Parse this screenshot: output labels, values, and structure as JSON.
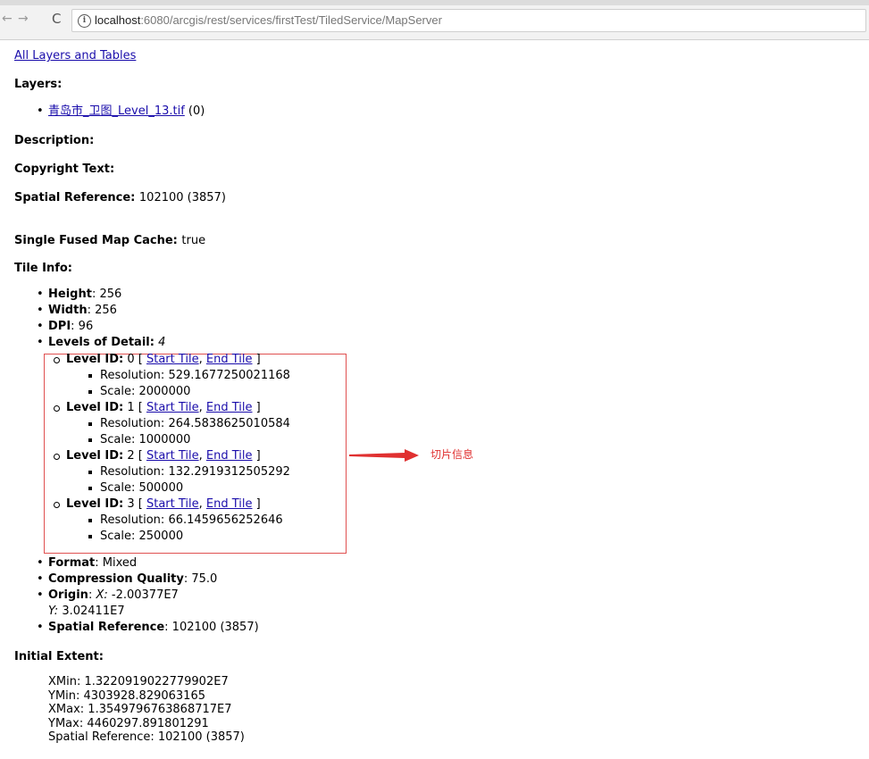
{
  "browser": {
    "url_host": "localhost",
    "url_path": ":6080/arcgis/rest/services/firstTest/TiledService/MapServer"
  },
  "page": {
    "all_layers_link": "All Layers and Tables",
    "layers_label": "Layers:",
    "layer_name": "青岛市_卫图_Level_13.tif",
    "layer_id": "(0)",
    "description_label": "Description:",
    "copyright_label": "Copyright Text:",
    "spatial_ref_label": "Spatial Reference:",
    "spatial_ref_value": "102100  (3857)",
    "fused_cache_label": "Single Fused Map Cache:",
    "fused_cache_value": "true",
    "tile_info_label": "Tile Info:"
  },
  "tile_info": {
    "height_label": "Height",
    "height_value": ": 256",
    "width_label": "Width",
    "width_value": ": 256",
    "dpi_label": "DPI",
    "dpi_value": ": 96",
    "lod_label": "Levels of Detail:",
    "lod_value": "4",
    "levels": [
      {
        "id_label": "Level ID:",
        "id": "0",
        "start": "Start Tile",
        "end": "End Tile",
        "resolution": "Resolution: 529.1677250021168",
        "scale": "Scale: 2000000"
      },
      {
        "id_label": "Level ID:",
        "id": "1",
        "start": "Start Tile",
        "end": "End Tile",
        "resolution": "Resolution: 264.5838625010584",
        "scale": "Scale: 1000000"
      },
      {
        "id_label": "Level ID:",
        "id": "2",
        "start": "Start Tile",
        "end": "End Tile",
        "resolution": "Resolution: 132.2919312505292",
        "scale": "Scale: 500000"
      },
      {
        "id_label": "Level ID:",
        "id": "3",
        "start": "Start Tile",
        "end": "End Tile",
        "resolution": "Resolution: 66.1459656252646",
        "scale": "Scale: 250000"
      }
    ],
    "format_label": "Format",
    "format_value": ": Mixed",
    "compression_label": "Compression Quality",
    "compression_value": ": 75.0",
    "origin_label": "Origin",
    "origin_x_label": "X:",
    "origin_x_value": "-2.00377E7",
    "origin_y_label": "Y:",
    "origin_y_value": "3.02411E7",
    "sr_label": "Spatial Reference",
    "sr_value": ": 102100  (3857)"
  },
  "extent": {
    "label": "Initial Extent:",
    "xmin": "XMin: 1.3220919022779902E7",
    "ymin": "YMin: 4303928.829063165",
    "xmax": "XMax: 1.3549796763868717E7",
    "ymax": "YMax: 4460297.891801291",
    "sr": "Spatial Reference: 102100  (3857)"
  },
  "annotation": {
    "text": "切片信息",
    "color": "#e03030"
  }
}
